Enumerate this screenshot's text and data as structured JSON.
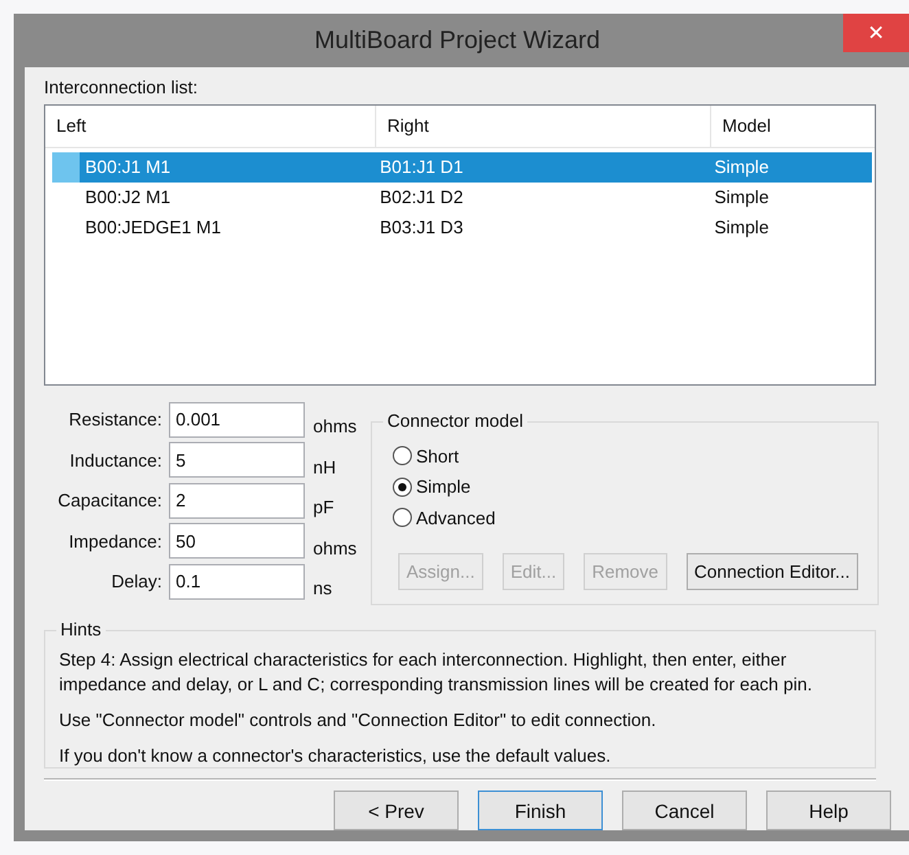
{
  "window": {
    "title": "MultiBoard Project Wizard",
    "close": "✕"
  },
  "interconnection_list": {
    "label": "Interconnection list:",
    "columns": [
      "Left",
      "Right",
      "Model"
    ],
    "rows": [
      {
        "left": "B00:J1 M1",
        "right": "B01:J1 D1",
        "model": "Simple",
        "selected": true
      },
      {
        "left": "B00:J2 M1",
        "right": "B02:J1 D2",
        "model": "Simple",
        "selected": false
      },
      {
        "left": "B00:JEDGE1 M1",
        "right": "B03:J1 D3",
        "model": "Simple",
        "selected": false
      }
    ]
  },
  "fields": [
    {
      "label": "Resistance:",
      "value": "0.001",
      "unit": "ohms"
    },
    {
      "label": "Inductance:",
      "value": "5",
      "unit": "nH"
    },
    {
      "label": "Capacitance:",
      "value": "2",
      "unit": "pF"
    },
    {
      "label": "Impedance:",
      "value": "50",
      "unit": "ohms"
    },
    {
      "label": "Delay:",
      "value": "0.1",
      "unit": "ns"
    }
  ],
  "connector_model": {
    "title": "Connector model",
    "options": [
      {
        "label": "Short",
        "selected": false
      },
      {
        "label": "Simple",
        "selected": true
      },
      {
        "label": "Advanced",
        "selected": false
      }
    ],
    "buttons": [
      {
        "label": "Assign...",
        "disabled": true
      },
      {
        "label": "Edit...",
        "disabled": true
      },
      {
        "label": "Remove",
        "disabled": true
      },
      {
        "label": "Connection Editor...",
        "disabled": false
      }
    ]
  },
  "hints": {
    "title": "Hints",
    "paragraphs": [
      "Step 4:  Assign electrical characteristics for each interconnection. Highlight, then enter, either impedance and delay, or L and C; corresponding transmission lines will be created for each pin.",
      "Use \"Connector model\" controls and \"Connection Editor\" to edit connection.",
      "If you don't know a connector's characteristics, use the default values."
    ]
  },
  "footer_buttons": [
    {
      "label": "< Prev",
      "default": false
    },
    {
      "label": "Finish",
      "default": true
    },
    {
      "label": "Cancel",
      "default": false
    },
    {
      "label": "Help",
      "default": false
    }
  ]
}
